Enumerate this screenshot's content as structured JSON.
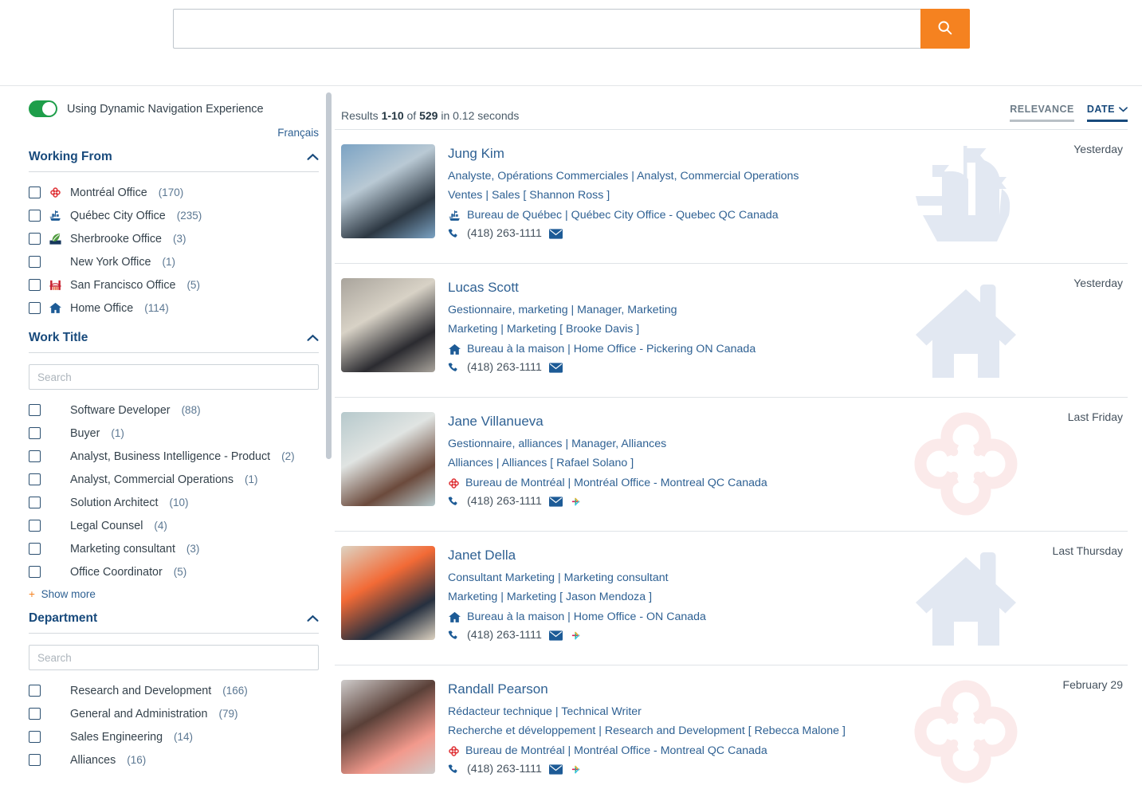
{
  "search": {
    "value": "",
    "placeholder": "",
    "button_icon": "search-icon",
    "button_color": "#f58220"
  },
  "sidebar": {
    "toggle": {
      "label": "Using Dynamic Navigation Experience",
      "state": "on",
      "color": "#1e9e4a"
    },
    "language_link": "Français",
    "facets": [
      {
        "title": "Working From",
        "collapsed": false,
        "has_search": false,
        "search_placeholder": "",
        "show_more": "",
        "items": [
          {
            "label": "Montréal Office",
            "count": "(170)",
            "icon": "montreal-clover-icon"
          },
          {
            "label": "Québec City Office",
            "count": "(235)",
            "icon": "ship-icon"
          },
          {
            "label": "Sherbrooke Office",
            "count": "(3)",
            "icon": "leaf-icon"
          },
          {
            "label": "New York Office",
            "count": "(1)",
            "icon": "none"
          },
          {
            "label": "San Francisco Office",
            "count": "(5)",
            "icon": "bridge-icon"
          },
          {
            "label": "Home Office",
            "count": "(114)",
            "icon": "home-icon"
          }
        ]
      },
      {
        "title": "Work Title",
        "collapsed": false,
        "has_search": true,
        "search_placeholder": "Search",
        "show_more": "Show more",
        "items": [
          {
            "label": "Software Developer",
            "count": "(88)",
            "icon": "none"
          },
          {
            "label": "Buyer",
            "count": "(1)",
            "icon": "none"
          },
          {
            "label": "Analyst, Business Intelligence - Product",
            "count": "(2)",
            "icon": "none"
          },
          {
            "label": "Analyst, Commercial Operations",
            "count": "(1)",
            "icon": "none"
          },
          {
            "label": "Solution Architect",
            "count": "(10)",
            "icon": "none"
          },
          {
            "label": "Legal Counsel",
            "count": "(4)",
            "icon": "none"
          },
          {
            "label": "Marketing consultant",
            "count": "(3)",
            "icon": "none"
          },
          {
            "label": "Office Coordinator",
            "count": "(5)",
            "icon": "none"
          }
        ]
      },
      {
        "title": "Department",
        "collapsed": false,
        "has_search": true,
        "search_placeholder": "Search",
        "show_more": "",
        "items": [
          {
            "label": "Research and Development",
            "count": "(166)",
            "icon": "none"
          },
          {
            "label": "General and Administration",
            "count": "(79)",
            "icon": "none"
          },
          {
            "label": "Sales Engineering",
            "count": "(14)",
            "icon": "none"
          },
          {
            "label": "Alliances",
            "count": "(16)",
            "icon": "none"
          }
        ]
      }
    ]
  },
  "results_header": {
    "prefix": "Results",
    "range": "1-10",
    "of": "of",
    "total": "529",
    "suffix": "in 0.12 seconds",
    "sort_relevance": "RELEVANCE",
    "sort_date": "DATE",
    "active_sort": "DATE"
  },
  "results": [
    {
      "name": "Jung Kim",
      "title_line": "Analyste, Opérations Commerciales | Analyst, Commercial Operations",
      "dept_line": "Ventes | Sales [ Shannon Ross ]",
      "office_icon": "ship-icon",
      "office_line": "Bureau de Québec | Québec City Office - Quebec QC Canada",
      "phone": "(418) 263-1111",
      "has_email": true,
      "has_slack": false,
      "date": "Yesterday",
      "watermark": "ship-watermark",
      "photo_colors": [
        "#7ba3c4",
        "#2c3742",
        "#b9c9d4"
      ]
    },
    {
      "name": "Lucas Scott",
      "title_line": "Gestionnaire, marketing | Manager, Marketing",
      "dept_line": "Marketing | Marketing [ Brooke Davis ]",
      "office_icon": "home-icon",
      "office_line": "Bureau à la maison | Home Office - Pickering ON Canada",
      "phone": "(418) 263-1111",
      "has_email": true,
      "has_slack": false,
      "date": "Yesterday",
      "watermark": "home-watermark",
      "photo_colors": [
        "#a9a49c",
        "#2b2b30",
        "#d8d2c6"
      ]
    },
    {
      "name": "Jane Villanueva",
      "title_line": "Gestionnaire, alliances | Manager, Alliances",
      "dept_line": "Alliances | Alliances [ Rafael Solano ]",
      "office_icon": "montreal-clover-icon",
      "office_line": "Bureau de Montréal | Montréal Office - Montreal QC Canada",
      "phone": "(418) 263-1111",
      "has_email": true,
      "has_slack": true,
      "date": "Last Friday",
      "watermark": "clover-watermark",
      "photo_colors": [
        "#b6c9cc",
        "#6b4a3c",
        "#e0e4e2"
      ]
    },
    {
      "name": "Janet Della",
      "title_line": "Consultant Marketing | Marketing consultant",
      "dept_line": "Marketing | Marketing [ Jason Mendoza ]",
      "office_icon": "home-icon",
      "office_line": "Bureau à la maison | Home Office - ON Canada",
      "phone": "(418) 263-1111",
      "has_email": true,
      "has_slack": true,
      "date": "Last Thursday",
      "watermark": "home-watermark",
      "photo_colors": [
        "#ded3c2",
        "#26303f",
        "#f26a36"
      ]
    },
    {
      "name": "Randall Pearson",
      "title_line": "Rédacteur technique | Technical Writer",
      "dept_line": "Recherche et développement | Research and Development [ Rebecca Malone ]",
      "office_icon": "montreal-clover-icon",
      "office_line": "Bureau de Montréal | Montréal Office - Montreal QC Canada",
      "phone": "(418) 263-1111",
      "has_email": true,
      "has_slack": true,
      "date": "February 29",
      "watermark": "clover-watermark",
      "photo_colors": [
        "#cfcccb",
        "#f2998c",
        "#5a4038"
      ]
    }
  ],
  "colors": {
    "accent_orange": "#f58220",
    "link_blue": "#2f6193",
    "heading_blue": "#184a7c",
    "toggle_green": "#1e9e4a",
    "montreal_red": "#e03a3e",
    "watermark_blue": "#e2e8f2",
    "watermark_pink": "#fbeaea"
  }
}
